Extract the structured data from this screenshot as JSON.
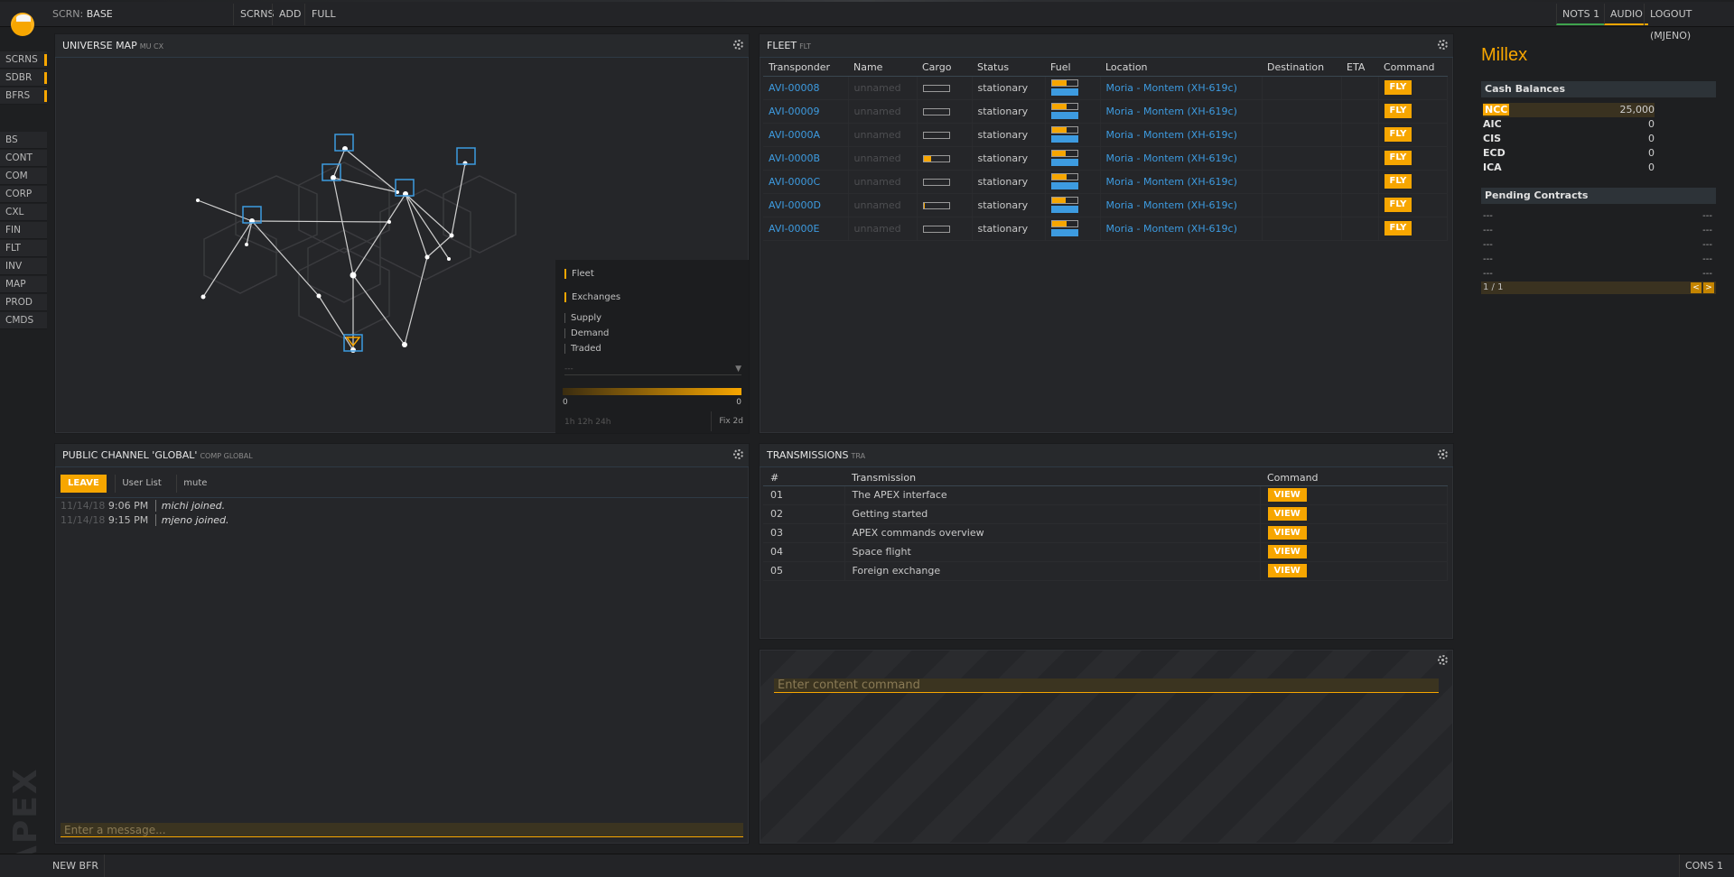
{
  "topbar": {
    "screen_prefix": "SCRN:",
    "screen_name": "BASE",
    "buttons": [
      "SCRNS",
      "ADD",
      "FULL"
    ],
    "right_buttons": [
      "NOTS 1",
      "AUDIO",
      "LOGOUT (MJENO)"
    ]
  },
  "sidebar": {
    "top_items": [
      "SCRNS",
      "SDBR",
      "BFRS"
    ],
    "items": [
      "BS",
      "CONT",
      "COM",
      "CORP",
      "CXL",
      "FIN",
      "FLT",
      "INV",
      "MAP",
      "PROD",
      "CMDS"
    ],
    "watermark": "APEX"
  },
  "map": {
    "title": "UNIVERSE MAP",
    "sub": "MU CX",
    "legend": {
      "fleet": "Fleet",
      "exchanges": "Exchanges",
      "supply": "Supply",
      "demand": "Demand",
      "traded": "Traded",
      "select_placeholder": "---",
      "range_min": "0",
      "range_max": "0",
      "periods": "1h  12h  24h",
      "fix": "Fix 2d"
    }
  },
  "fleet": {
    "title": "FLEET",
    "sub": "FLT",
    "columns": [
      "Transponder",
      "Name",
      "Cargo",
      "Status",
      "Fuel",
      "Location",
      "Destination",
      "ETA",
      "Command"
    ],
    "rows": [
      {
        "transponder": "AVI-00008",
        "name": "unnamed",
        "cargo": 0.0,
        "status": "stationary",
        "fuel": 0.6,
        "location": "Moria - Montem (XH-619c)",
        "command": "FLY"
      },
      {
        "transponder": "AVI-00009",
        "name": "unnamed",
        "cargo": 0.0,
        "status": "stationary",
        "fuel": 0.6,
        "location": "Moria - Montem (XH-619c)",
        "command": "FLY"
      },
      {
        "transponder": "AVI-0000A",
        "name": "unnamed",
        "cargo": 0.0,
        "status": "stationary",
        "fuel": 0.6,
        "location": "Moria - Montem (XH-619c)",
        "command": "FLY"
      },
      {
        "transponder": "AVI-0000B",
        "name": "unnamed",
        "cargo": 0.3,
        "status": "stationary",
        "fuel": 0.55,
        "location": "Moria - Montem (XH-619c)",
        "command": "FLY"
      },
      {
        "transponder": "AVI-0000C",
        "name": "unnamed",
        "cargo": 0.0,
        "status": "stationary",
        "fuel": 0.6,
        "location": "Moria - Montem (XH-619c)",
        "command": "FLY"
      },
      {
        "transponder": "AVI-0000D",
        "name": "unnamed",
        "cargo": 0.05,
        "status": "stationary",
        "fuel": 0.55,
        "location": "Moria - Montem (XH-619c)",
        "command": "FLY"
      },
      {
        "transponder": "AVI-0000E",
        "name": "unnamed",
        "cargo": 0.0,
        "status": "stationary",
        "fuel": 0.6,
        "location": "Moria - Montem (XH-619c)",
        "command": "FLY"
      }
    ]
  },
  "chat": {
    "title": "PUBLIC CHANNEL 'GLOBAL'",
    "sub": "COMP GLOBAL",
    "leave": "LEAVE",
    "user_list": "User List",
    "mute": "mute",
    "messages": [
      {
        "date": "11/14/18",
        "time": "9:06 PM",
        "text": "michi joined."
      },
      {
        "date": "11/14/18",
        "time": "9:15 PM",
        "text": "mjeno joined."
      }
    ],
    "input_placeholder": "Enter a message..."
  },
  "transmissions": {
    "title": "TRANSMISSIONS",
    "sub": "TRA",
    "columns": [
      "#",
      "Transmission",
      "Command"
    ],
    "rows": [
      {
        "num": "01",
        "title": "The APEX interface",
        "command": "VIEW"
      },
      {
        "num": "02",
        "title": "Getting started",
        "command": "VIEW"
      },
      {
        "num": "03",
        "title": "APEX commands overview",
        "command": "VIEW"
      },
      {
        "num": "04",
        "title": "Space flight",
        "command": "VIEW"
      },
      {
        "num": "05",
        "title": "Foreign exchange",
        "command": "VIEW"
      }
    ]
  },
  "command": {
    "placeholder": "Enter content command"
  },
  "corp": {
    "name": "Millex",
    "cash_title": "Cash Balances",
    "balances": [
      {
        "currency": "NCC",
        "value": "25,000"
      },
      {
        "currency": "AIC",
        "value": "0"
      },
      {
        "currency": "CIS",
        "value": "0"
      },
      {
        "currency": "ECD",
        "value": "0"
      },
      {
        "currency": "ICA",
        "value": "0"
      }
    ],
    "contracts_title": "Pending Contracts",
    "contracts": [
      "---",
      "---",
      "---",
      "---",
      "---"
    ],
    "contracts_right": [
      "---",
      "---",
      "---",
      "---",
      "---"
    ],
    "pager": "1 / 1",
    "prev": "<",
    "next": ">"
  },
  "bottombar": {
    "new_bfr": "NEW BFR",
    "cons": "CONS 1"
  },
  "colors": {
    "accent": "#f7a600",
    "link": "#3d9be0",
    "background": "#1e1f21"
  }
}
